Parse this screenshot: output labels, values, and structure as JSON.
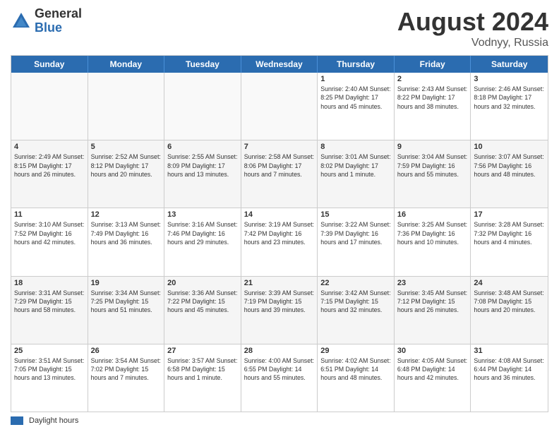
{
  "logo": {
    "general": "General",
    "blue": "Blue"
  },
  "title": {
    "month": "August 2024",
    "location": "Vodnyy, Russia"
  },
  "header_days": [
    "Sunday",
    "Monday",
    "Tuesday",
    "Wednesday",
    "Thursday",
    "Friday",
    "Saturday"
  ],
  "weeks": [
    [
      {
        "day": "",
        "info": ""
      },
      {
        "day": "",
        "info": ""
      },
      {
        "day": "",
        "info": ""
      },
      {
        "day": "",
        "info": ""
      },
      {
        "day": "1",
        "info": "Sunrise: 2:40 AM\nSunset: 8:25 PM\nDaylight: 17 hours\nand 45 minutes."
      },
      {
        "day": "2",
        "info": "Sunrise: 2:43 AM\nSunset: 8:22 PM\nDaylight: 17 hours\nand 38 minutes."
      },
      {
        "day": "3",
        "info": "Sunrise: 2:46 AM\nSunset: 8:18 PM\nDaylight: 17 hours\nand 32 minutes."
      }
    ],
    [
      {
        "day": "4",
        "info": "Sunrise: 2:49 AM\nSunset: 8:15 PM\nDaylight: 17 hours\nand 26 minutes."
      },
      {
        "day": "5",
        "info": "Sunrise: 2:52 AM\nSunset: 8:12 PM\nDaylight: 17 hours\nand 20 minutes."
      },
      {
        "day": "6",
        "info": "Sunrise: 2:55 AM\nSunset: 8:09 PM\nDaylight: 17 hours\nand 13 minutes."
      },
      {
        "day": "7",
        "info": "Sunrise: 2:58 AM\nSunset: 8:06 PM\nDaylight: 17 hours\nand 7 minutes."
      },
      {
        "day": "8",
        "info": "Sunrise: 3:01 AM\nSunset: 8:02 PM\nDaylight: 17 hours\nand 1 minute."
      },
      {
        "day": "9",
        "info": "Sunrise: 3:04 AM\nSunset: 7:59 PM\nDaylight: 16 hours\nand 55 minutes."
      },
      {
        "day": "10",
        "info": "Sunrise: 3:07 AM\nSunset: 7:56 PM\nDaylight: 16 hours\nand 48 minutes."
      }
    ],
    [
      {
        "day": "11",
        "info": "Sunrise: 3:10 AM\nSunset: 7:52 PM\nDaylight: 16 hours\nand 42 minutes."
      },
      {
        "day": "12",
        "info": "Sunrise: 3:13 AM\nSunset: 7:49 PM\nDaylight: 16 hours\nand 36 minutes."
      },
      {
        "day": "13",
        "info": "Sunrise: 3:16 AM\nSunset: 7:46 PM\nDaylight: 16 hours\nand 29 minutes."
      },
      {
        "day": "14",
        "info": "Sunrise: 3:19 AM\nSunset: 7:42 PM\nDaylight: 16 hours\nand 23 minutes."
      },
      {
        "day": "15",
        "info": "Sunrise: 3:22 AM\nSunset: 7:39 PM\nDaylight: 16 hours\nand 17 minutes."
      },
      {
        "day": "16",
        "info": "Sunrise: 3:25 AM\nSunset: 7:36 PM\nDaylight: 16 hours\nand 10 minutes."
      },
      {
        "day": "17",
        "info": "Sunrise: 3:28 AM\nSunset: 7:32 PM\nDaylight: 16 hours\nand 4 minutes."
      }
    ],
    [
      {
        "day": "18",
        "info": "Sunrise: 3:31 AM\nSunset: 7:29 PM\nDaylight: 15 hours\nand 58 minutes."
      },
      {
        "day": "19",
        "info": "Sunrise: 3:34 AM\nSunset: 7:25 PM\nDaylight: 15 hours\nand 51 minutes."
      },
      {
        "day": "20",
        "info": "Sunrise: 3:36 AM\nSunset: 7:22 PM\nDaylight: 15 hours\nand 45 minutes."
      },
      {
        "day": "21",
        "info": "Sunrise: 3:39 AM\nSunset: 7:19 PM\nDaylight: 15 hours\nand 39 minutes."
      },
      {
        "day": "22",
        "info": "Sunrise: 3:42 AM\nSunset: 7:15 PM\nDaylight: 15 hours\nand 32 minutes."
      },
      {
        "day": "23",
        "info": "Sunrise: 3:45 AM\nSunset: 7:12 PM\nDaylight: 15 hours\nand 26 minutes."
      },
      {
        "day": "24",
        "info": "Sunrise: 3:48 AM\nSunset: 7:08 PM\nDaylight: 15 hours\nand 20 minutes."
      }
    ],
    [
      {
        "day": "25",
        "info": "Sunrise: 3:51 AM\nSunset: 7:05 PM\nDaylight: 15 hours\nand 13 minutes."
      },
      {
        "day": "26",
        "info": "Sunrise: 3:54 AM\nSunset: 7:02 PM\nDaylight: 15 hours\nand 7 minutes."
      },
      {
        "day": "27",
        "info": "Sunrise: 3:57 AM\nSunset: 6:58 PM\nDaylight: 15 hours\nand 1 minute."
      },
      {
        "day": "28",
        "info": "Sunrise: 4:00 AM\nSunset: 6:55 PM\nDaylight: 14 hours\nand 55 minutes."
      },
      {
        "day": "29",
        "info": "Sunrise: 4:02 AM\nSunset: 6:51 PM\nDaylight: 14 hours\nand 48 minutes."
      },
      {
        "day": "30",
        "info": "Sunrise: 4:05 AM\nSunset: 6:48 PM\nDaylight: 14 hours\nand 42 minutes."
      },
      {
        "day": "31",
        "info": "Sunrise: 4:08 AM\nSunset: 6:44 PM\nDaylight: 14 hours\nand 36 minutes."
      }
    ]
  ],
  "footer": {
    "swatch_label": "Daylight hours"
  },
  "shaded_rows": [
    1,
    3
  ],
  "accent_color": "#2b6cb0"
}
